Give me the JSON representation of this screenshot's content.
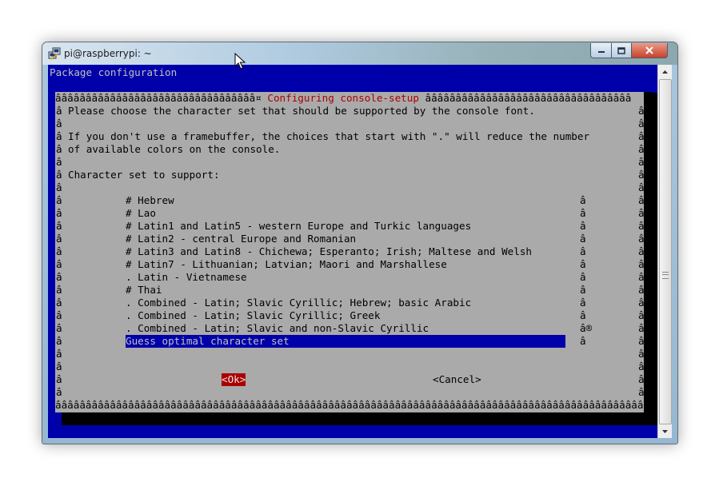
{
  "window": {
    "title": "pi@raspberrypi: ~"
  },
  "terminal": {
    "header": "Package configuration",
    "dialog": {
      "border_fill_left": "âââââââââââââââââââââââââââââââââ¤ ",
      "title": "Configuring console-setup",
      "border_fill_right": " ââââââââââââââââââââââââââââââââââ",
      "border_char": "â",
      "bottom_border": "âââââââââââââââââââââââââââââââââââââââââââââââââââââââââââââââââââââââââââââââââââââââââââââââââââââââ",
      "prompt_line1": "Please choose the character set that should be supported by the console font.",
      "info_line1": "If you don't use a framebuffer, the choices that start with \".\" will reduce the number",
      "info_line2": "of available colors on the console.",
      "question": "Character set to support:",
      "options": [
        "# Hebrew",
        "# Lao",
        "# Latin1 and Latin5 - western Europe and Turkic languages",
        "# Latin2 - central Europe and Romanian",
        "# Latin3 and Latin8 - Chichewa; Esperanto; Irish; Maltese and Welsh",
        "# Latin7 - Lithuanian; Latvian; Maori and Marshallese",
        ". Latin - Vietnamese",
        "# Thai",
        ". Combined - Latin; Slavic Cyrillic; Hebrew; basic Arabic",
        ". Combined - Latin; Slavic Cyrillic; Greek",
        ". Combined - Latin; Slavic and non-Slavic Cyrillic",
        "Guess optimal character set"
      ],
      "selected_option": "Guess optimal character set",
      "scroll_char": "â",
      "scroll_thumb": "â®",
      "ok_label": "<Ok>",
      "cancel_label": "<Cancel>"
    }
  },
  "colors": {
    "terminal_bg": "#0000aa",
    "dialog_bg": "#aaaaaa",
    "title_red": "#aa0000",
    "ok_button_bg": "#aa0000"
  }
}
